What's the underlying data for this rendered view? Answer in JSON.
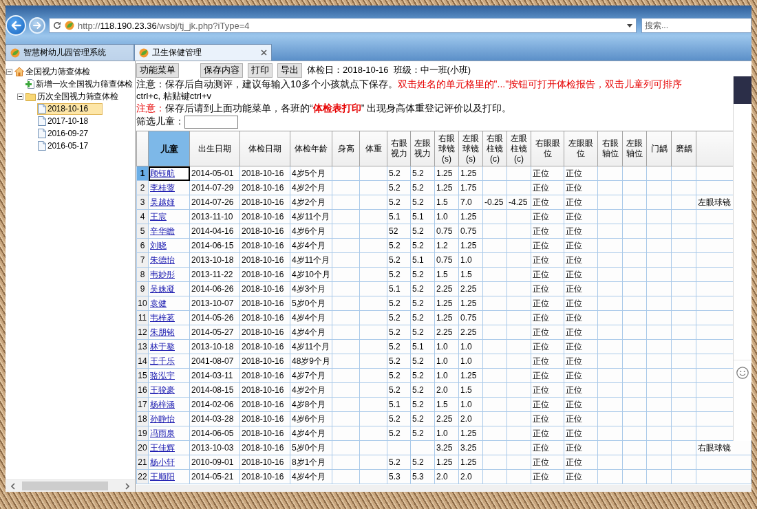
{
  "browser": {
    "address": {
      "scheme": "http://",
      "host": "118.190.23.36",
      "path": "/wsbj/tj_jk.php?iType=4"
    },
    "search": {
      "placeholder": "搜索..."
    },
    "tabs": [
      {
        "label": "智慧树幼儿园管理系统",
        "selected": false
      },
      {
        "label": "卫生保健管理",
        "selected": true
      }
    ]
  },
  "tree": [
    {
      "label": "全国视力筛查体检",
      "kind": "home",
      "expanded": true,
      "selected": false,
      "children": [
        {
          "label": "新增一次全国视力筛查体检",
          "kind": "add",
          "selected": false
        },
        {
          "label": "历次全国视力筛查体检",
          "kind": "folder",
          "expanded": true,
          "selected": false,
          "children": [
            {
              "label": "2018-10-16",
              "kind": "page",
              "selected": true
            },
            {
              "label": "2017-10-18",
              "kind": "page",
              "selected": false
            },
            {
              "label": "2016-09-27",
              "kind": "page",
              "selected": false
            },
            {
              "label": "2016-05-17",
              "kind": "page",
              "selected": false
            }
          ]
        }
      ]
    }
  ],
  "toolbar": {
    "buttons": [
      "功能菜单",
      "保存内容",
      "打印",
      "导出"
    ],
    "exam_day": "体检日：2018-10-16",
    "class_name": "班级：中一班(小班)"
  },
  "notice_1": {
    "text": "注意：保存后自动测评，建议每输入10多个小孩就点下保存。",
    "warning": "双击姓名的单元格里的\"...\"按钮可打开体检报告，双击儿童列可排序"
  },
  "notice_1_continued": "ctrl+c, 粘贴键ctrl+v",
  "notice_2": {
    "label": "注意：",
    "text": "保存后请到上面功能菜单，各班的“**体检表打印**” 出现身高体重登记评价以及打印。"
  },
  "filter": {
    "label": "筛选儿童："
  },
  "table": {
    "columns": [
      {
        "label": "儿童",
        "selected": true
      },
      {
        "label": "出生日期",
        "selected": false
      },
      {
        "label": "体检日期",
        "selected": false
      },
      {
        "label": "体检年龄",
        "selected": false
      },
      {
        "label": "身高",
        "selected": false
      },
      {
        "label": "体重",
        "selected": false
      },
      {
        "label": "右眼视力",
        "selected": false
      },
      {
        "label": "左眼视力",
        "selected": false
      },
      {
        "label": "右眼球镜(s)",
        "selected": false
      },
      {
        "label": "左眼球镜(s)",
        "selected": false
      },
      {
        "label": "右眼柱镜(c)",
        "selected": false
      },
      {
        "label": "左眼柱镜(c)",
        "selected": false
      },
      {
        "label": "右眼眼位",
        "selected": false
      },
      {
        "label": "左眼眼位",
        "selected": false
      },
      {
        "label": "右眼轴位",
        "selected": false
      },
      {
        "label": "左眼轴位",
        "selected": false
      },
      {
        "label": "门龋",
        "selected": false
      },
      {
        "label": "磨龋",
        "selected": false
      }
    ],
    "rows": [
      {
        "number": "1",
        "selected": true,
        "name": "顾钰航",
        "birth_date": "2014-05-01",
        "exam_date": "2018-10-16",
        "exam_age": "4岁5个月",
        "right_vision": "5.2",
        "left_vision": "5.2",
        "right_sphere": "1.25",
        "left_sphere": "1.25",
        "right_position": "正位",
        "left_position": "正位"
      },
      {
        "number": "2",
        "selected": false,
        "name": "李桂蓥",
        "birth_date": "2014-07-29",
        "exam_date": "2018-10-16",
        "exam_age": "4岁2个月",
        "right_vision": "5.2",
        "left_vision": "5.2",
        "right_sphere": "1.25",
        "left_sphere": "1.75",
        "right_position": "正位",
        "left_position": "正位"
      },
      {
        "number": "3",
        "selected": false,
        "name": "吴越嫤",
        "birth_date": "2014-07-26",
        "exam_date": "2018-10-16",
        "exam_age": "4岁2个月",
        "right_vision": "5.2",
        "left_vision": "5.2",
        "right_sphere": "1.5",
        "left_sphere": "7.0",
        "right_cylinder": "-0.25",
        "left_cylinder": "-4.25",
        "right_position": "正位",
        "left_position": "正位",
        "column_20": "左眼球镜"
      },
      {
        "number": "4",
        "selected": false,
        "name": "王宸",
        "birth_date": "2013-11-10",
        "exam_date": "2018-10-16",
        "exam_age": "4岁11个月",
        "right_vision": "5.1",
        "left_vision": "5.1",
        "right_sphere": "1.0",
        "left_sphere": "1.25",
        "right_position": "正位",
        "left_position": "正位"
      },
      {
        "number": "5",
        "selected": false,
        "name": "辛华瞻",
        "birth_date": "2014-04-16",
        "exam_date": "2018-10-16",
        "exam_age": "4岁6个月",
        "right_vision": "52",
        "left_vision": "5.2",
        "right_sphere": "0.75",
        "left_sphere": "0.75",
        "right_position": "正位",
        "left_position": "正位"
      },
      {
        "number": "6",
        "selected": false,
        "name": "刘晓",
        "birth_date": "2014-06-15",
        "exam_date": "2018-10-16",
        "exam_age": "4岁4个月",
        "right_vision": "5.2",
        "left_vision": "5.2",
        "right_sphere": "1.2",
        "left_sphere": "1.25",
        "right_position": "正位",
        "left_position": "正位"
      },
      {
        "number": "7",
        "selected": false,
        "name": "朱德怡",
        "birth_date": "2013-10-18",
        "exam_date": "2018-10-16",
        "exam_age": "4岁11个月",
        "right_vision": "5.2",
        "left_vision": "5.1",
        "right_sphere": "0.75",
        "left_sphere": "1.0",
        "right_position": "正位",
        "left_position": "正位"
      },
      {
        "number": "8",
        "selected": false,
        "name": "韦妙彤",
        "birth_date": "2013-11-22",
        "exam_date": "2018-10-16",
        "exam_age": "4岁10个月",
        "right_vision": "5.2",
        "left_vision": "5.2",
        "right_sphere": "1.5",
        "left_sphere": "1.5",
        "right_position": "正位",
        "left_position": "正位"
      },
      {
        "number": "9",
        "selected": false,
        "name": "吴姝凝",
        "birth_date": "2014-06-26",
        "exam_date": "2018-10-16",
        "exam_age": "4岁3个月",
        "right_vision": "5.1",
        "left_vision": "5.2",
        "right_sphere": "2.25",
        "left_sphere": "2.25",
        "right_position": "正位",
        "left_position": "正位"
      },
      {
        "number": "10",
        "selected": false,
        "name": "袁健",
        "birth_date": "2013-10-07",
        "exam_date": "2018-10-16",
        "exam_age": "5岁0个月",
        "right_vision": "5.2",
        "left_vision": "5.2",
        "right_sphere": "1.25",
        "left_sphere": "1.25",
        "right_position": "正位",
        "left_position": "正位"
      },
      {
        "number": "11",
        "selected": false,
        "name": "韦梓茗",
        "birth_date": "2014-05-26",
        "exam_date": "2018-10-16",
        "exam_age": "4岁4个月",
        "right_vision": "5.2",
        "left_vision": "5.2",
        "right_sphere": "1.25",
        "left_sphere": "0.75",
        "right_position": "正位",
        "left_position": "正位"
      },
      {
        "number": "12",
        "selected": false,
        "name": "朱朋铭",
        "birth_date": "2014-05-27",
        "exam_date": "2018-10-16",
        "exam_age": "4岁4个月",
        "right_vision": "5.2",
        "left_vision": "5.2",
        "right_sphere": "2.25",
        "left_sphere": "2.25",
        "right_position": "正位",
        "left_position": "正位"
      },
      {
        "number": "13",
        "selected": false,
        "name": "林于鏊",
        "birth_date": "2013-10-18",
        "exam_date": "2018-10-16",
        "exam_age": "4岁11个月",
        "right_vision": "5.2",
        "left_vision": "5.1",
        "right_sphere": "1.0",
        "left_sphere": "1.0",
        "right_position": "正位",
        "left_position": "正位"
      },
      {
        "number": "14",
        "selected": false,
        "name": "王千乐",
        "birth_date": "2041-08-07",
        "exam_date": "2018-10-16",
        "exam_age": "48岁9个月",
        "right_vision": "5.2",
        "left_vision": "5.2",
        "right_sphere": "1.0",
        "left_sphere": "1.0",
        "right_position": "正位",
        "left_position": "正位"
      },
      {
        "number": "15",
        "selected": false,
        "name": "骆泓宇",
        "birth_date": "2014-03-11",
        "exam_date": "2018-10-16",
        "exam_age": "4岁7个月",
        "right_vision": "5.2",
        "left_vision": "5.2",
        "right_sphere": "1.0",
        "left_sphere": "1.25",
        "right_position": "正位",
        "left_position": "正位"
      },
      {
        "number": "16",
        "selected": false,
        "name": "王骏豪",
        "birth_date": "2014-08-15",
        "exam_date": "2018-10-16",
        "exam_age": "4岁2个月",
        "right_vision": "5.2",
        "left_vision": "5.2",
        "right_sphere": "2.0",
        "left_sphere": "1.5",
        "right_position": "正位",
        "left_position": "正位"
      },
      {
        "number": "17",
        "selected": false,
        "name": "杨梓涵",
        "birth_date": "2014-02-06",
        "exam_date": "2018-10-16",
        "exam_age": "4岁8个月",
        "right_vision": "5.1",
        "left_vision": "5.2",
        "right_sphere": "1.5",
        "left_sphere": "1.0",
        "right_position": "正位",
        "left_position": "正位"
      },
      {
        "number": "18",
        "selected": false,
        "name": "孙静怡",
        "birth_date": "2014-03-28",
        "exam_date": "2018-10-16",
        "exam_age": "4岁6个月",
        "right_vision": "5.2",
        "left_vision": "5.2",
        "right_sphere": "2.25",
        "left_sphere": "2.0",
        "right_position": "正位",
        "left_position": "正位"
      },
      {
        "number": "19",
        "selected": false,
        "name": "冯雨泉",
        "birth_date": "2014-06-05",
        "exam_date": "2018-10-16",
        "exam_age": "4岁4个月",
        "right_vision": "5.2",
        "left_vision": "5.2",
        "right_sphere": "1.0",
        "left_sphere": "1.25",
        "right_position": "正位",
        "left_position": "正位"
      },
      {
        "number": "20",
        "selected": false,
        "name": "王佳辉",
        "birth_date": "2013-10-03",
        "exam_date": "2018-10-16",
        "exam_age": "5岁0个月",
        "right_sphere": "3.25",
        "left_sphere": "3.25",
        "right_position": "正位",
        "left_position": "正位",
        "column_20": "右眼球镜"
      },
      {
        "number": "21",
        "selected": false,
        "name": "杨小轩",
        "birth_date": "2010-09-01",
        "exam_date": "2018-10-16",
        "exam_age": "8岁1个月",
        "right_vision": "5.2",
        "left_vision": "5.2",
        "right_sphere": "1.25",
        "left_sphere": "1.25",
        "right_position": "正位",
        "left_position": "正位"
      },
      {
        "number": "22",
        "selected": false,
        "name": "王顺阳",
        "birth_date": "2014-05-21",
        "exam_date": "2018-10-16",
        "exam_age": "4岁4个月",
        "right_vision": "5.3",
        "left_vision": "5.3",
        "right_sphere": "2.0",
        "left_sphere": "2.0",
        "right_position": "正位",
        "left_position": "正位"
      }
    ]
  }
}
